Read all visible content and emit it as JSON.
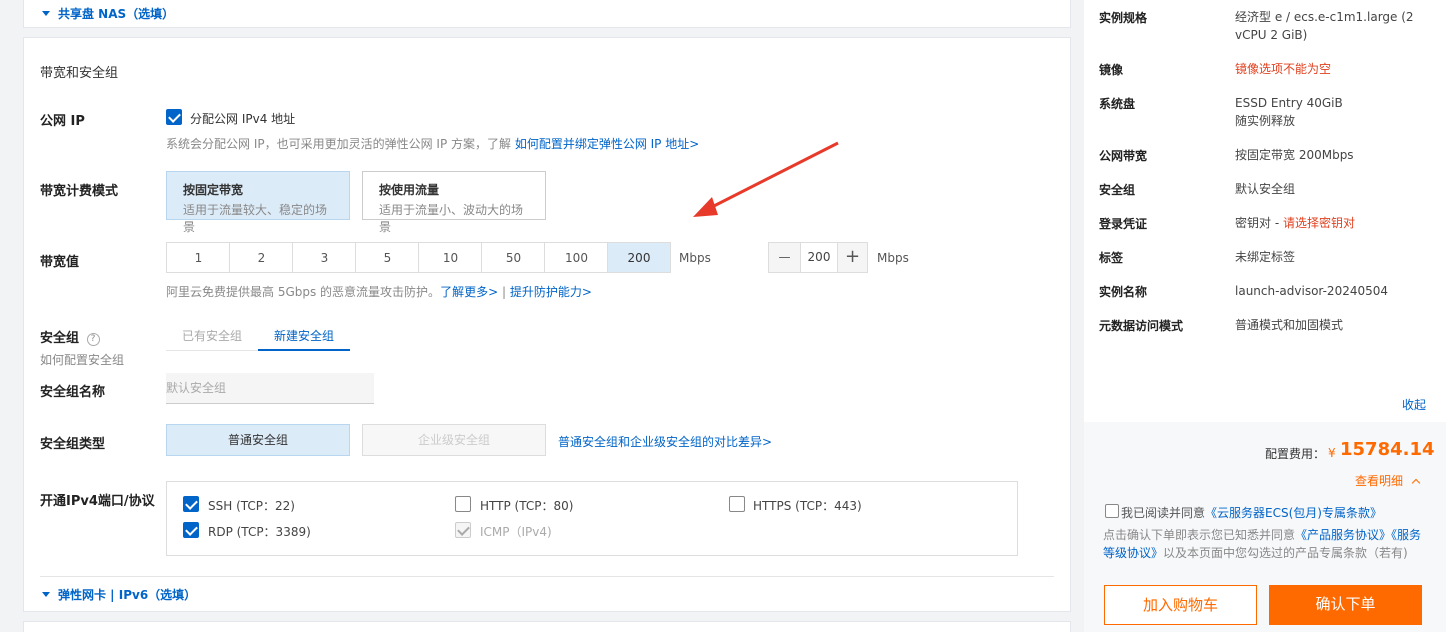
{
  "nas_section": {
    "label": "共享盘 NAS（选填）"
  },
  "bandwidth_section": {
    "title": "带宽和安全组",
    "public_ip": {
      "label": "公网 IP",
      "checkbox_label": "分配公网 IPv4 地址",
      "checked": true,
      "hint": "系统会分配公网 IP，也可采用更加灵活的弹性公网 IP 方案，了解 ",
      "hint_link": "如何配置并绑定弹性公网 IP 地址>"
    },
    "billing_mode": {
      "label": "带宽计费模式",
      "options": [
        {
          "title": "按固定带宽",
          "desc": "适用于流量较大、稳定的场景",
          "selected": true
        },
        {
          "title": "按使用流量",
          "desc": "适用于流量小、波动大的场景",
          "selected": false
        }
      ]
    },
    "bandwidth_value": {
      "label": "带宽值",
      "options": [
        "1",
        "2",
        "3",
        "5",
        "10",
        "50",
        "100",
        "200"
      ],
      "selected": "200",
      "unit": "Mbps",
      "stepper_value": "200",
      "stepper_unit": "Mbps",
      "minus": "—",
      "plus": "+",
      "hint": "阿里云免费提供最高 5Gbps 的恶意流量攻击防护。",
      "hint_link1": "了解更多>",
      "hint_sep": "|",
      "hint_link2": "提升防护能力>"
    },
    "security_group": {
      "label": "安全组",
      "help_icon": "?",
      "sub_link": "如何配置安全组",
      "tabs": [
        {
          "label": "已有安全组",
          "active": false
        },
        {
          "label": "新建安全组",
          "active": true
        }
      ],
      "name_label": "安全组名称",
      "name_placeholder": "默认安全组",
      "type_label": "安全组类型",
      "types": [
        {
          "label": "普通安全组",
          "selected": true,
          "disabled": false
        },
        {
          "label": "企业级安全组",
          "selected": false,
          "disabled": true
        }
      ],
      "type_link": "普通安全组和企业级安全组的对比差异>",
      "ports_label": "开通IPv4端口/协议",
      "ports": [
        {
          "label": "SSH (TCP：22)",
          "checked": true,
          "disabled": false
        },
        {
          "label": "HTTP (TCP：80)",
          "checked": false,
          "disabled": false
        },
        {
          "label": "HTTPS (TCP：443)",
          "checked": false,
          "disabled": false
        },
        {
          "label": "RDP (TCP：3389)",
          "checked": true,
          "disabled": false
        },
        {
          "label": "ICMP（IPv4)",
          "checked": true,
          "disabled": true
        }
      ]
    }
  },
  "eni_section": {
    "label": "弹性网卡 | IPv6（选填）"
  },
  "summary": {
    "rows": [
      {
        "key": "实例规格",
        "value": "经济型 e / ecs.e-c1m1.large (2 vCPU 2 GiB)"
      },
      {
        "key": "镜像",
        "value": "镜像选项不能为空"
      },
      {
        "key": "系统盘",
        "value": "ESSD Entry 40GiB",
        "value2": "随实例释放"
      },
      {
        "key": "公网带宽",
        "value": "按固定带宽 200Mbps"
      },
      {
        "key": "安全组",
        "value": "默认安全组"
      },
      {
        "key": "登录凭证",
        "value": "密钥对 - ",
        "value_link": "请选择密钥对"
      },
      {
        "key": "标签",
        "value": "未绑定标签"
      },
      {
        "key": "实例名称",
        "value": "launch-advisor-20240504"
      },
      {
        "key": "元数据访问模式",
        "value": "普通模式和加固模式"
      }
    ],
    "collapse": "收起",
    "fee_label": "配置费用：",
    "currency": "¥",
    "fee_value": "15784.14",
    "details_link": "查看明细",
    "agree_prefix": "我已阅读并同意",
    "agree_link": "《云服务器ECS(包月)专属条款》",
    "notice_prefix": "点击确认下单即表示您已知悉并同意",
    "notice_link1": "《产品服务协议》",
    "notice_link2": "《服务等级协议》",
    "notice_suffix": "以及本页面中您勾选过的产品专属条款（若有)",
    "add_cart": "加入购物车",
    "confirm": "确认下单"
  },
  "colors": {
    "primary": "#0064c8",
    "accent": "#ff6a00",
    "error": "#e0401f",
    "selected_bg": "#dcebf8"
  }
}
